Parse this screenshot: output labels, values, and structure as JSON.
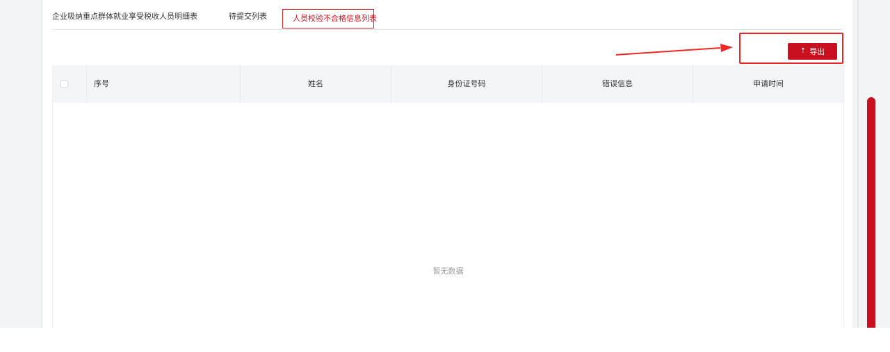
{
  "tabs": [
    {
      "label": "企业吸纳重点群体就业享受税收人员明细表"
    },
    {
      "label": "待提交列表"
    },
    {
      "label": "人员校验不合格信息列表"
    }
  ],
  "toolbar": {
    "export_icon": "upload-icon",
    "export_label": "导出"
  },
  "table": {
    "columns": [
      "序号",
      "姓名",
      "身份证号码",
      "错误信息",
      "申请时间"
    ],
    "rows": [],
    "empty_text": "暂无数据"
  },
  "colors": {
    "accent": "#c8101e",
    "highlight": "#f02525"
  }
}
